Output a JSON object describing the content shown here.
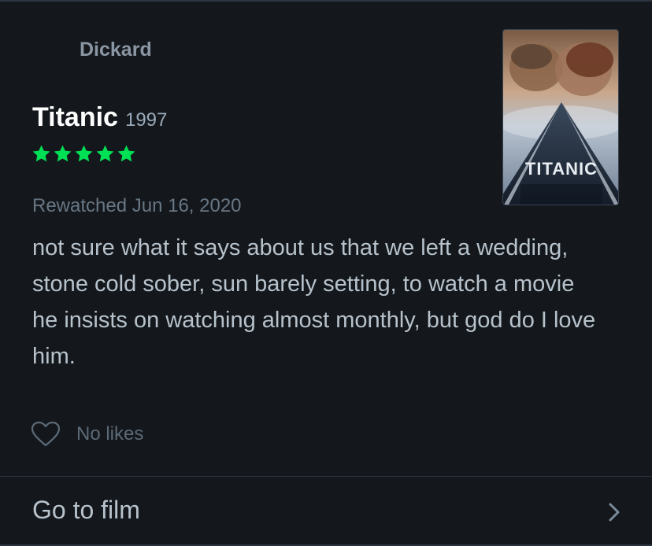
{
  "review": {
    "reviewer_name": "Dickard",
    "film_title": "Titanic",
    "film_year": "1997",
    "rating_stars": 5,
    "rating_max": 5,
    "star_color": "#00e054",
    "watched_label": "Rewatched Jun 16, 2020",
    "text": "not sure what it says about us that we left a wedding, stone cold sober, sun barely setting, to watch a movie he insists on watching almost monthly, but god do I love him."
  },
  "poster": {
    "title_text": "TITANIC"
  },
  "likes": {
    "label": "No likes",
    "icon": "heart-outline-icon"
  },
  "footer": {
    "goto_label": "Go to film",
    "icon": "chevron-right-icon"
  },
  "colors": {
    "background": "#14181c",
    "divider": "#2c3440"
  }
}
